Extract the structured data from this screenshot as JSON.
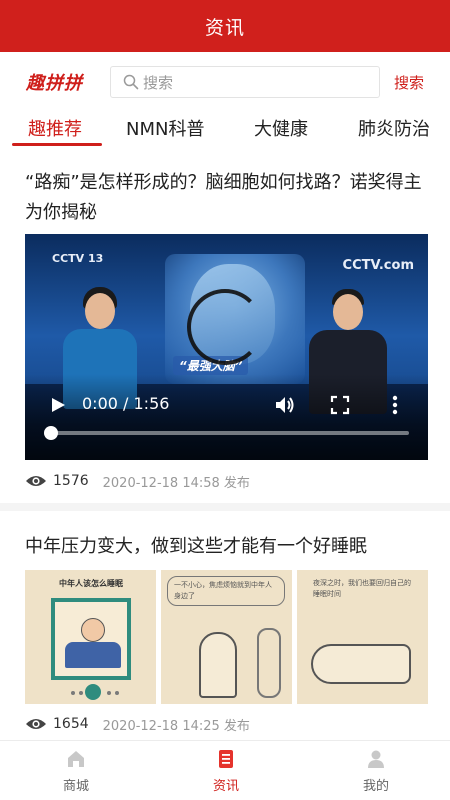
{
  "header": {
    "title": "资讯"
  },
  "search": {
    "brand": "趣拼拼",
    "placeholder": "搜索",
    "button_label": "搜索"
  },
  "tabs": [
    {
      "label": "趣推荐",
      "active": true
    },
    {
      "label": "NMN科普",
      "active": false
    },
    {
      "label": "大健康",
      "active": false
    },
    {
      "label": "肺炎防治",
      "active": false
    }
  ],
  "articles": [
    {
      "title": "“路痴”是怎样形成的？脑细胞如何找路？诺奖得主为你揭秘",
      "video": {
        "time": "0:00 / 1:56",
        "progress": 0.0,
        "logo_left": "CCTV 13",
        "logo_right": "CCTV.com",
        "caption": "“最强大脑”"
      },
      "views": "1576",
      "date": "2020-12-18 14:58 发布"
    },
    {
      "title": "中年压力变大，做到这些才能有一个好睡眠",
      "images": [
        {
          "text": "中年人该怎么睡眠"
        },
        {
          "text": "一不小心，焦虑烦恼就到中年人身边了"
        },
        {
          "text": "夜深之时，我们也要回归自己的睡眠时间"
        }
      ],
      "views": "1654",
      "date": "2020-12-18 14:25 发布"
    }
  ],
  "bottom_nav": [
    {
      "label": "商城",
      "icon": "home-icon",
      "active": false
    },
    {
      "label": "资讯",
      "icon": "news-icon",
      "active": true
    },
    {
      "label": "我的",
      "icon": "user-icon",
      "active": false
    }
  ],
  "colors": {
    "brand_red": "#d0201c",
    "muted": "#999999"
  }
}
